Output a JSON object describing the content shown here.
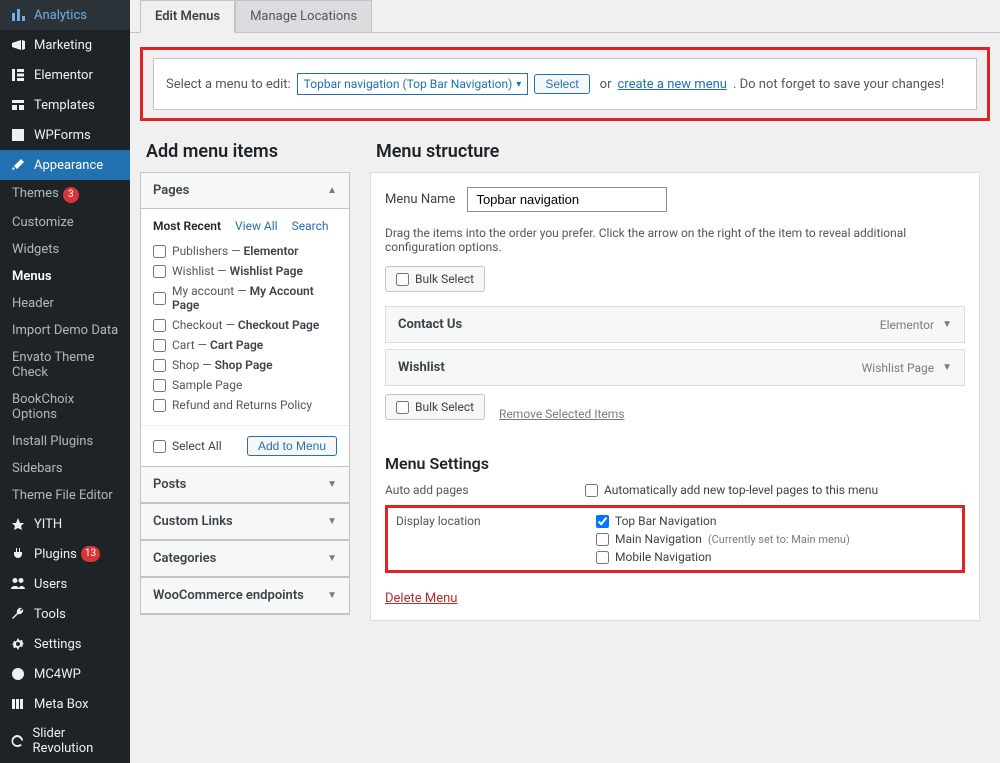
{
  "sidebar": {
    "items": [
      {
        "label": "Analytics",
        "icon": "analytics"
      },
      {
        "label": "Marketing",
        "icon": "megaphone"
      },
      {
        "label": "Elementor",
        "icon": "elementor"
      },
      {
        "label": "Templates",
        "icon": "templates"
      },
      {
        "label": "WPForms",
        "icon": "wpforms"
      },
      {
        "label": "Appearance",
        "icon": "brush",
        "active": true
      },
      {
        "label": "YITH",
        "icon": "yith"
      },
      {
        "label": "Plugins",
        "icon": "plug",
        "badge": "13"
      },
      {
        "label": "Users",
        "icon": "users"
      },
      {
        "label": "Tools",
        "icon": "tools"
      },
      {
        "label": "Settings",
        "icon": "settings"
      },
      {
        "label": "MC4WP",
        "icon": "mc4wp"
      },
      {
        "label": "Meta Box",
        "icon": "metabox"
      },
      {
        "label": "Slider Revolution",
        "icon": "slider"
      }
    ],
    "appearance_sub": [
      {
        "label": "Themes",
        "badge": "3"
      },
      {
        "label": "Customize"
      },
      {
        "label": "Widgets"
      },
      {
        "label": "Menus",
        "current": true
      },
      {
        "label": "Header"
      },
      {
        "label": "Import Demo Data"
      },
      {
        "label": "Envato Theme Check"
      },
      {
        "label": "BookChoix Options"
      },
      {
        "label": "Install Plugins"
      },
      {
        "label": "Sidebars"
      },
      {
        "label": "Theme File Editor"
      }
    ]
  },
  "tabs": {
    "edit": "Edit Menus",
    "manage": "Manage Locations"
  },
  "selectbar": {
    "prompt": "Select a menu to edit:",
    "current": "Topbar navigation (Top Bar Navigation)",
    "select_btn": "Select",
    "or": "or",
    "create_link": "create a new menu",
    "note": ". Do not forget to save your changes!"
  },
  "headings": {
    "add": "Add menu items",
    "structure": "Menu structure",
    "settings": "Menu Settings"
  },
  "pagesPanel": {
    "title": "Pages",
    "subtabs": {
      "recent": "Most Recent",
      "viewall": "View All",
      "search": "Search"
    },
    "items": [
      {
        "pre": "Publishers — ",
        "bold": "Elementor"
      },
      {
        "pre": "Wishlist — ",
        "bold": "Wishlist Page"
      },
      {
        "pre": "My account — ",
        "bold": "My Account Page"
      },
      {
        "pre": "Checkout — ",
        "bold": "Checkout Page"
      },
      {
        "pre": "Cart — ",
        "bold": "Cart Page"
      },
      {
        "pre": "Shop — ",
        "bold": "Shop Page"
      },
      {
        "pre": "Sample Page",
        "bold": ""
      },
      {
        "pre": "Refund and Returns Policy",
        "bold": ""
      }
    ],
    "selectAll": "Select All",
    "addBtn": "Add to Menu"
  },
  "collapsedPanels": [
    "Posts",
    "Custom Links",
    "Categories",
    "WooCommerce endpoints"
  ],
  "menuForm": {
    "nameLabel": "Menu Name",
    "nameValue": "Topbar navigation",
    "desc": "Drag the items into the order you prefer. Click the arrow on the right of the item to reveal additional configuration options.",
    "bulk": "Bulk Select",
    "items": [
      {
        "title": "Contact Us",
        "type": "Elementor"
      },
      {
        "title": "Wishlist",
        "type": "Wishlist Page"
      }
    ],
    "removeSelected": "Remove Selected Items",
    "autoAddLabel": "Auto add pages",
    "autoAddOpt": "Automatically add new top-level pages to this menu",
    "displayLabel": "Display location",
    "locations": [
      {
        "label": "Top Bar Navigation",
        "checked": true
      },
      {
        "label": "Main Navigation",
        "note": "(Currently set to: Main menu)"
      },
      {
        "label": "Mobile Navigation"
      }
    ],
    "delete": "Delete Menu"
  }
}
